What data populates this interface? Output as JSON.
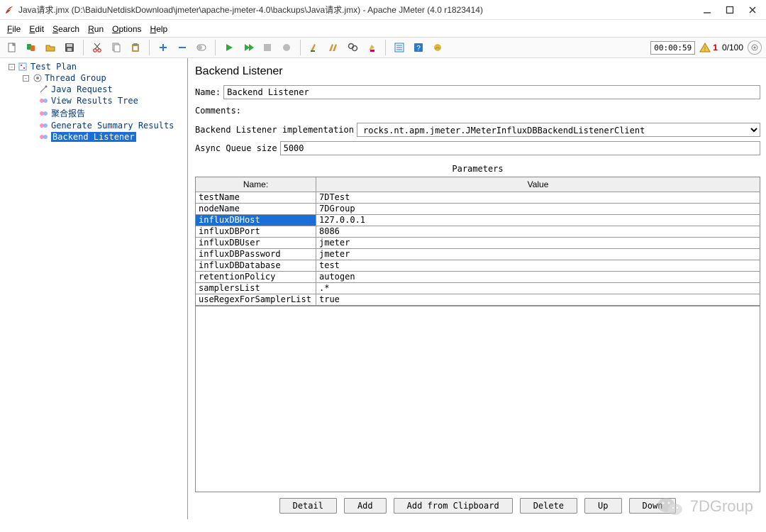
{
  "title": "Java请求.jmx (D:\\BaiduNetdiskDownload\\jmeter\\apache-jmeter-4.0\\backups\\Java请求.jmx) - Apache JMeter (4.0 r1823414)",
  "menu": [
    "File",
    "Edit",
    "Search",
    "Run",
    "Options",
    "Help"
  ],
  "timer": "00:00:59",
  "warn_count": "1",
  "thread_count": "0/100",
  "tree": {
    "root": "Test Plan",
    "group": "Thread Group",
    "items": [
      "Java Request",
      "View Results Tree",
      "聚合报告",
      "Generate Summary Results",
      "Backend Listener"
    ],
    "selected": "Backend Listener"
  },
  "panel": {
    "heading": "Backend Listener",
    "name_label": "Name:",
    "name_value": "Backend Listener",
    "comments_label": "Comments:",
    "comments_value": "",
    "impl_label": "Backend Listener implementation",
    "impl_value": "rocks.nt.apm.jmeter.JMeterInfluxDBBackendListenerClient",
    "queue_label": "Async Queue size",
    "queue_value": "5000",
    "params_title": "Parameters",
    "col_name": "Name:",
    "col_value": "Value",
    "rows": [
      {
        "name": "testName",
        "value": "7DTest"
      },
      {
        "name": "nodeName",
        "value": "7DGroup"
      },
      {
        "name": "influxDBHost",
        "value": "127.0.0.1"
      },
      {
        "name": "influxDBPort",
        "value": "8086"
      },
      {
        "name": "influxDBUser",
        "value": "jmeter"
      },
      {
        "name": "influxDBPassword",
        "value": "jmeter"
      },
      {
        "name": "influxDBDatabase",
        "value": "test"
      },
      {
        "name": "retentionPolicy",
        "value": "autogen"
      },
      {
        "name": "samplersList",
        "value": ".*"
      },
      {
        "name": "useRegexForSamplerList",
        "value": "true"
      }
    ],
    "selected_row": 2
  },
  "buttons": [
    "Detail",
    "Add",
    "Add from Clipboard",
    "Delete",
    "Up",
    "Down"
  ],
  "watermark": "7DGroup"
}
